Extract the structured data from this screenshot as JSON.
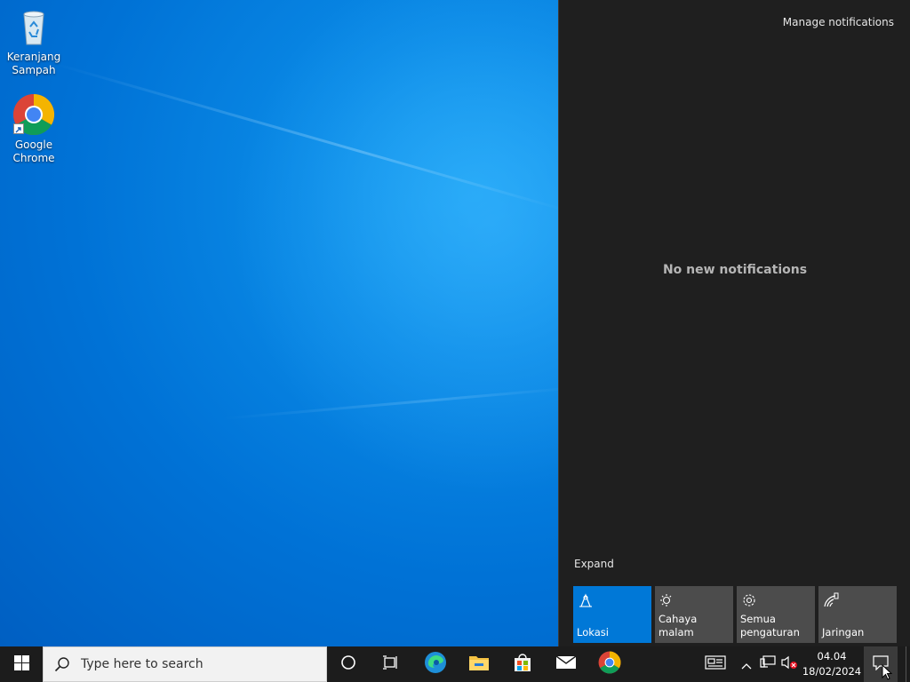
{
  "desktop": {
    "icons": [
      {
        "label_line1": "Keranjang",
        "label_line2": "Sampah",
        "icon": "recycle-bin-icon"
      },
      {
        "label_line1": "Google",
        "label_line2": "Chrome",
        "icon": "chrome-icon"
      }
    ]
  },
  "action_center": {
    "manage_label": "Manage notifications",
    "empty_message": "No new notifications",
    "expand_label": "Expand",
    "tiles": [
      {
        "label": "Lokasi",
        "icon": "location-icon",
        "active": true
      },
      {
        "label": "Cahaya malam",
        "icon": "night-light-icon",
        "active": false
      },
      {
        "label": "Semua pengaturan",
        "label_line1": "Semua",
        "label_line2": "pengaturan",
        "icon": "settings-gear-icon",
        "active": false
      },
      {
        "label": "Jaringan",
        "icon": "network-icon",
        "active": false
      }
    ]
  },
  "taskbar": {
    "search_placeholder": "Type here to search",
    "pinned": [
      "cortana-icon",
      "task-view-icon",
      "edge-icon",
      "file-explorer-icon",
      "store-icon",
      "mail-icon",
      "chrome-icon"
    ],
    "tray_icons": [
      "news-icon",
      "chevron-up-icon",
      "network-tray-icon",
      "volume-muted-icon"
    ],
    "clock_time": "04.04",
    "clock_date": "18/02/2024"
  },
  "colors": {
    "accent": "#0078d7",
    "panel_bg": "#1f1f1f",
    "tile_bg": "#4c4c4c",
    "taskbar_bg": "#1c1c1c"
  }
}
